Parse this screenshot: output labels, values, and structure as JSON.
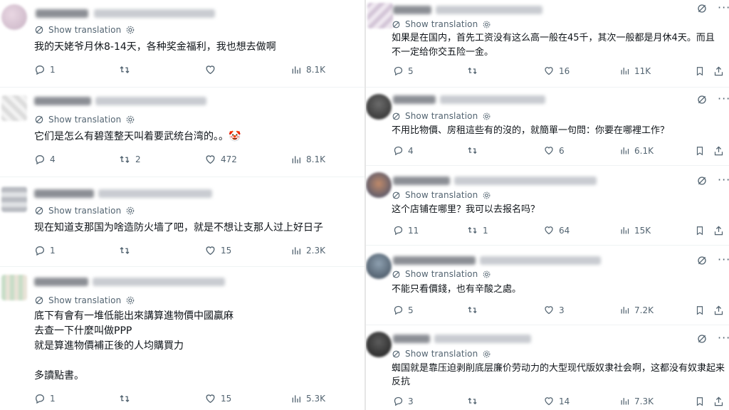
{
  "translate_label": "Show translation",
  "left_posts": [
    {
      "text": "我的天姥爷月休8-14天，各种奖金福利，我也想去做啊",
      "replies": "1",
      "reposts": "",
      "likes": "",
      "views": "8.1K"
    },
    {
      "text": "它们是怎么有碧莲整天叫着要武统台湾的。。🤡",
      "replies": "4",
      "reposts": "2",
      "likes": "472",
      "views": "8.1K"
    },
    {
      "text": "现在知道支那国为啥造防火墙了吧，就是不想让支那人过上好日子",
      "replies": "1",
      "reposts": "",
      "likes": "15",
      "views": "2.3K"
    },
    {
      "text": "底下有會有一堆低能出來講算進物價中國贏麻\n去查一下什麼叫做PPP\n就是算進物價補正後的人均購買力\n\n多讀點書。",
      "replies": "1",
      "reposts": "",
      "likes": "15",
      "views": "5.3K"
    }
  ],
  "right_posts": [
    {
      "text": "如果是在国内，首先工资没有这么高一般在45千，其次一般都是月休4天。而且不一定给你交五险一金。",
      "replies": "5",
      "reposts": "",
      "likes": "16",
      "views": "11K"
    },
    {
      "text": "不用比物價、房租這些有的沒的，就簡單一句問：你要在哪裡工作？",
      "replies": "4",
      "reposts": "",
      "likes": "6",
      "views": "6.1K"
    },
    {
      "text": "这个店铺在哪里？我可以去报名吗？",
      "replies": "11",
      "reposts": "1",
      "likes": "64",
      "views": "15K"
    },
    {
      "text": "不能只看價錢，也有辛酸之處。",
      "replies": "5",
      "reposts": "",
      "likes": "3",
      "views": "7.2K"
    },
    {
      "text": "蜘国就是靠压迫剥削底层廉价劳动力的大型现代版奴隶社会啊，这都没有奴隶起来反抗",
      "replies": "3",
      "reposts": "",
      "likes": "14",
      "views": "7.3K"
    }
  ]
}
